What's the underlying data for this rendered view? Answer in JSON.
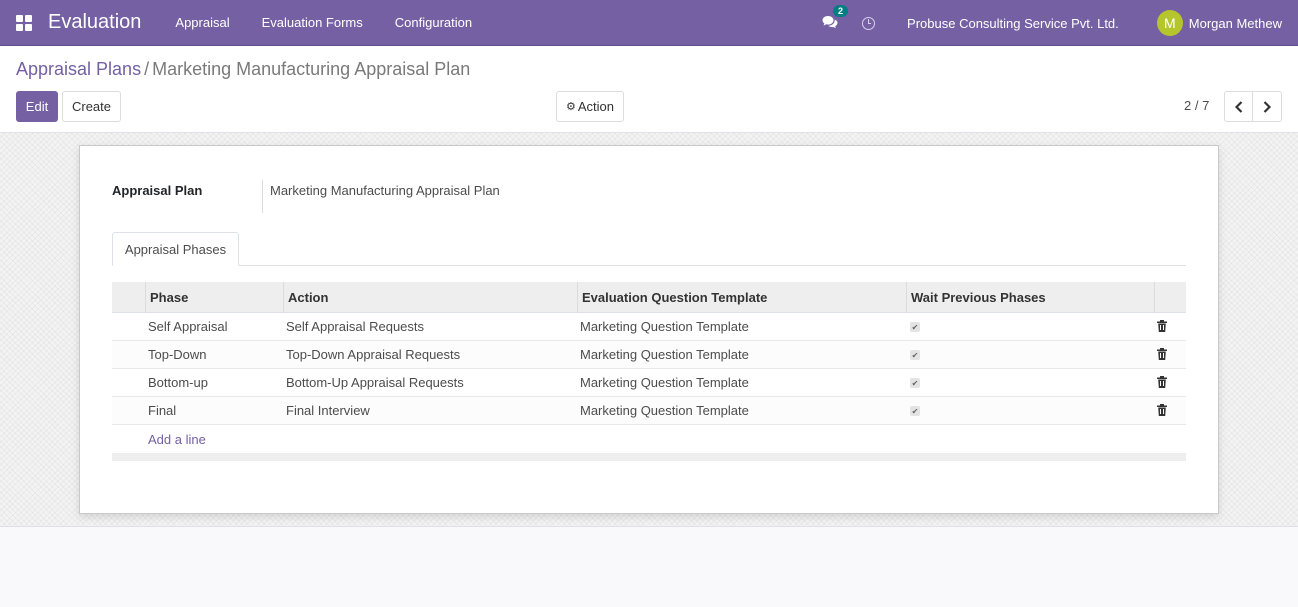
{
  "navbar": {
    "app_name": "Evaluation",
    "menu": [
      "Appraisal",
      "Evaluation Forms",
      "Configuration"
    ],
    "chat_count": "2",
    "company": "Probuse Consulting Service Pvt. Ltd.",
    "user_initial": "M",
    "user_name": "Morgan Methew",
    "color": "#7460a3",
    "avatar_color": "#b5c62d"
  },
  "breadcrumb": {
    "parent": "Appraisal Plans",
    "separator": "/",
    "current": "Marketing Manufacturing Appraisal Plan"
  },
  "toolbar": {
    "edit_label": "Edit",
    "create_label": "Create",
    "action_label": "Action"
  },
  "pager": {
    "value": "2 / 7"
  },
  "form": {
    "field_label": "Appraisal Plan",
    "field_value": "Marketing Manufacturing Appraisal Plan",
    "tab_label": "Appraisal Phases",
    "columns": [
      "Phase",
      "Action",
      "Evaluation Question Template",
      "Wait Previous Phases"
    ],
    "rows": [
      {
        "phase": "Self Appraisal",
        "action": "Self Appraisal Requests",
        "template": "Marketing Question Template",
        "wait": true
      },
      {
        "phase": "Top-Down",
        "action": "Top-Down Appraisal Requests",
        "template": "Marketing Question Template",
        "wait": true
      },
      {
        "phase": "Bottom-up",
        "action": "Bottom-Up Appraisal Requests",
        "template": "Marketing Question Template",
        "wait": true
      },
      {
        "phase": "Final",
        "action": "Final Interview",
        "template": "Marketing Question Template",
        "wait": true
      }
    ],
    "add_line_label": "Add a line"
  }
}
